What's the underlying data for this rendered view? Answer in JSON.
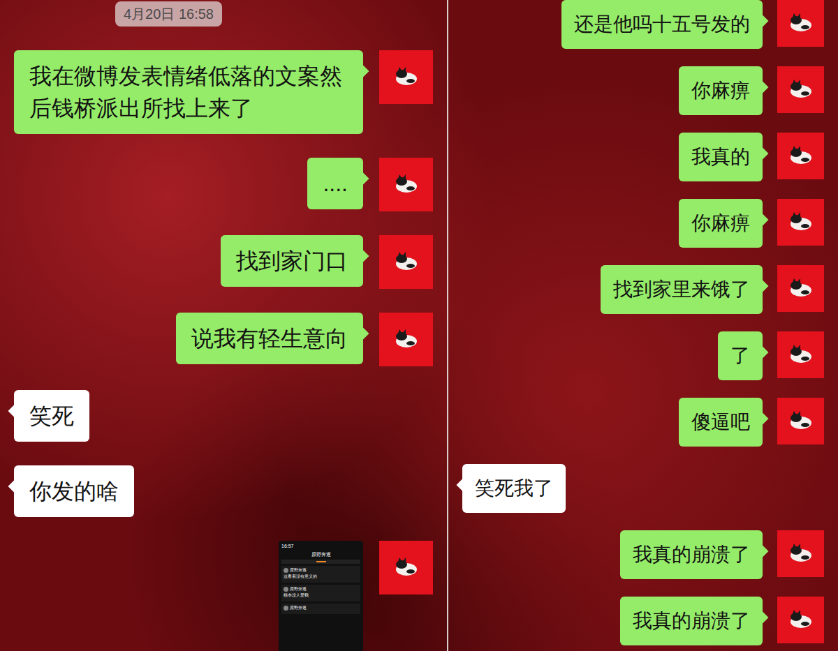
{
  "panels": [
    {
      "timestamp": "4月20日 16:58",
      "messages": [
        {
          "kind": "text",
          "sender": "me",
          "text": "我在微博发表情绪低落的文案然后钱桥派出所找上来了"
        },
        {
          "kind": "text",
          "sender": "me",
          "text": "...."
        },
        {
          "kind": "text",
          "sender": "me",
          "text": "找到家门口"
        },
        {
          "kind": "text",
          "sender": "me",
          "text": "说我有轻生意向"
        },
        {
          "kind": "text",
          "sender": "friend",
          "text": "笑死"
        },
        {
          "kind": "text",
          "sender": "friend",
          "text": "你发的啥"
        },
        {
          "kind": "image",
          "sender": "me",
          "image": {
            "time": "16:57",
            "title": "原野奔逐",
            "posts": [
              {
                "name": "原野奔逐",
                "text": "这看着没有意义的"
              },
              {
                "name": "原野奔逐",
                "text": "根本没人爱我"
              },
              {
                "name": "原野奔逐",
                "text": ""
              }
            ]
          }
        }
      ]
    },
    {
      "timestamp": "",
      "messages": [
        {
          "kind": "text",
          "sender": "me",
          "text": "还是他吗十五号发的"
        },
        {
          "kind": "text",
          "sender": "me",
          "text": "你麻痹"
        },
        {
          "kind": "text",
          "sender": "me",
          "text": "我真的"
        },
        {
          "kind": "text",
          "sender": "me",
          "text": "你麻痹"
        },
        {
          "kind": "text",
          "sender": "me",
          "text": "找到家里来饿了"
        },
        {
          "kind": "text",
          "sender": "me",
          "text": "了"
        },
        {
          "kind": "text",
          "sender": "me",
          "text": "傻逼吧"
        },
        {
          "kind": "text",
          "sender": "friend",
          "text": "笑死我了"
        },
        {
          "kind": "text",
          "sender": "me",
          "text": "我真的崩溃了"
        },
        {
          "kind": "text",
          "sender": "me",
          "text": "我真的崩溃了"
        }
      ]
    }
  ]
}
